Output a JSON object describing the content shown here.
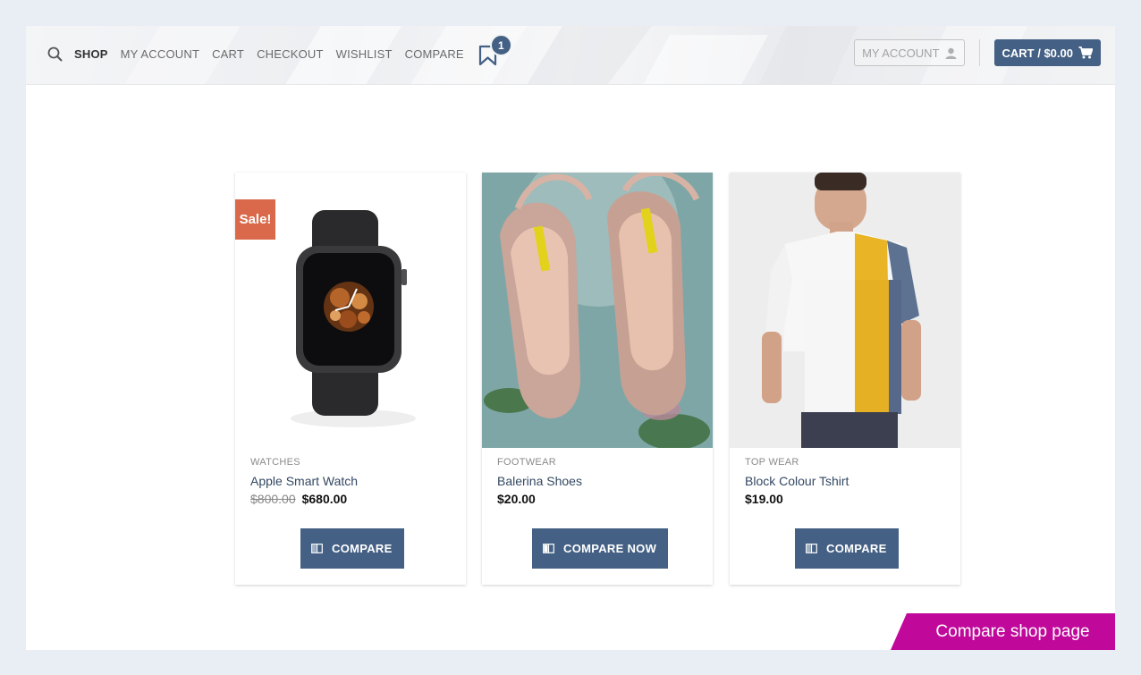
{
  "nav": {
    "items": [
      "SHOP",
      "MY ACCOUNT",
      "CART",
      "CHECKOUT",
      "WISHLIST",
      "COMPARE"
    ],
    "active": "SHOP",
    "wishlist_count": "1"
  },
  "header": {
    "account_label": "MY ACCOUNT",
    "cart_label": "CART / $0.00"
  },
  "products": [
    {
      "category": "WATCHES",
      "name": "Apple Smart Watch",
      "old_price": "$800.00",
      "price": "$680.00",
      "badge": "Sale!",
      "button": "COMPARE"
    },
    {
      "category": "FOOTWEAR",
      "name": "Balerina Shoes",
      "price": "$20.00",
      "button": "COMPARE NOW"
    },
    {
      "category": "TOP WEAR",
      "name": "Block Colour Tshirt",
      "price": "$19.00",
      "button": "COMPARE"
    }
  ],
  "ribbon": "Compare shop page",
  "colors": {
    "primary": "#446084",
    "sale": "#d9694a",
    "ribbon": "#c0099b",
    "link": "#334862"
  },
  "icons": [
    "search-icon",
    "bookmark-icon",
    "user-icon",
    "cart-icon",
    "compare-icon"
  ]
}
